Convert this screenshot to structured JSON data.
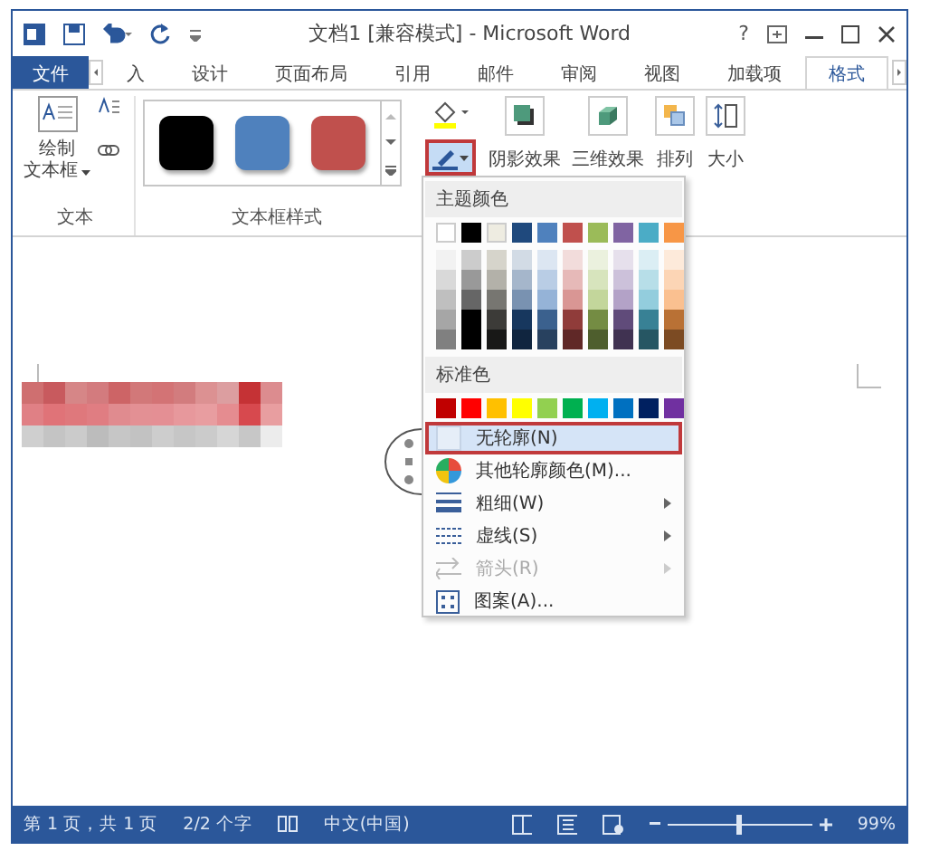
{
  "window": {
    "title": "文档1 [兼容模式] - Microsoft Word",
    "help": "?"
  },
  "tabs": [
    {
      "label": "文件",
      "kind": "file",
      "selected": false
    },
    {
      "label": "入",
      "selected": false
    },
    {
      "label": "设计",
      "selected": false
    },
    {
      "label": "页面布局",
      "selected": false
    },
    {
      "label": "引用",
      "selected": false
    },
    {
      "label": "邮件",
      "selected": false
    },
    {
      "label": "审阅",
      "selected": false
    },
    {
      "label": "视图",
      "selected": false
    },
    {
      "label": "加载项",
      "selected": false
    },
    {
      "label": "格式",
      "selected": true
    }
  ],
  "ribbon": {
    "text_group": {
      "draw_button": [
        "绘制",
        "文本框"
      ],
      "label": "文本"
    },
    "styles_group": {
      "label": "文本框样式",
      "styles": [
        {
          "color": "#000000"
        },
        {
          "color": "#4f81bd"
        },
        {
          "color": "#c0504d"
        }
      ]
    },
    "outline_button": {
      "selected": true
    },
    "buttons": [
      {
        "label": "阴影效果",
        "kind": "shadow"
      },
      {
        "label": "三维效果",
        "kind": "cube"
      },
      {
        "label": "排列",
        "kind": "arrange"
      },
      {
        "label": "大小",
        "kind": "size"
      }
    ]
  },
  "outline_menu": {
    "theme_header": "主题颜色",
    "theme_colors": [
      {
        "color": "#ffffff"
      },
      {
        "color": "#000000"
      },
      {
        "color": "#eeece1"
      },
      {
        "color": "#1f497d"
      },
      {
        "color": "#4f81bd"
      },
      {
        "color": "#c0504d"
      },
      {
        "color": "#9bbb59"
      },
      {
        "color": "#8064a2"
      },
      {
        "color": "#4bacc6"
      },
      {
        "color": "#f79646"
      }
    ],
    "standard_header": "标准色",
    "standard_colors": [
      {
        "color": "#c00000"
      },
      {
        "color": "#ff0000"
      },
      {
        "color": "#ffc000"
      },
      {
        "color": "#ffff00"
      },
      {
        "color": "#92d050"
      },
      {
        "color": "#00b050"
      },
      {
        "color": "#00b0f0"
      },
      {
        "color": "#0070c0"
      },
      {
        "color": "#002060"
      },
      {
        "color": "#7030a0"
      }
    ],
    "items": [
      {
        "label": "无轮廓(N)",
        "kind": "none",
        "selected": true,
        "disabled": false,
        "submenu": false
      },
      {
        "label": "其他轮廓颜色(M)...",
        "kind": "palette",
        "selected": false,
        "disabled": false,
        "submenu": false
      },
      {
        "label": "粗细(W)",
        "kind": "weight",
        "selected": false,
        "disabled": false,
        "submenu": true
      },
      {
        "label": "虚线(S)",
        "kind": "dash",
        "selected": false,
        "disabled": false,
        "submenu": true
      },
      {
        "label": "箭头(R)",
        "kind": "arrow",
        "selected": false,
        "disabled": true,
        "submenu": true
      },
      {
        "label": "图案(A)...",
        "kind": "pattern",
        "selected": false,
        "disabled": false,
        "submenu": false
      }
    ]
  },
  "status_bar": {
    "page": "第 1 页，共 1 页",
    "words": "2/2 个字",
    "language": "中文(中国)",
    "zoom": {
      "level": 0.5,
      "reading": "99%"
    }
  }
}
